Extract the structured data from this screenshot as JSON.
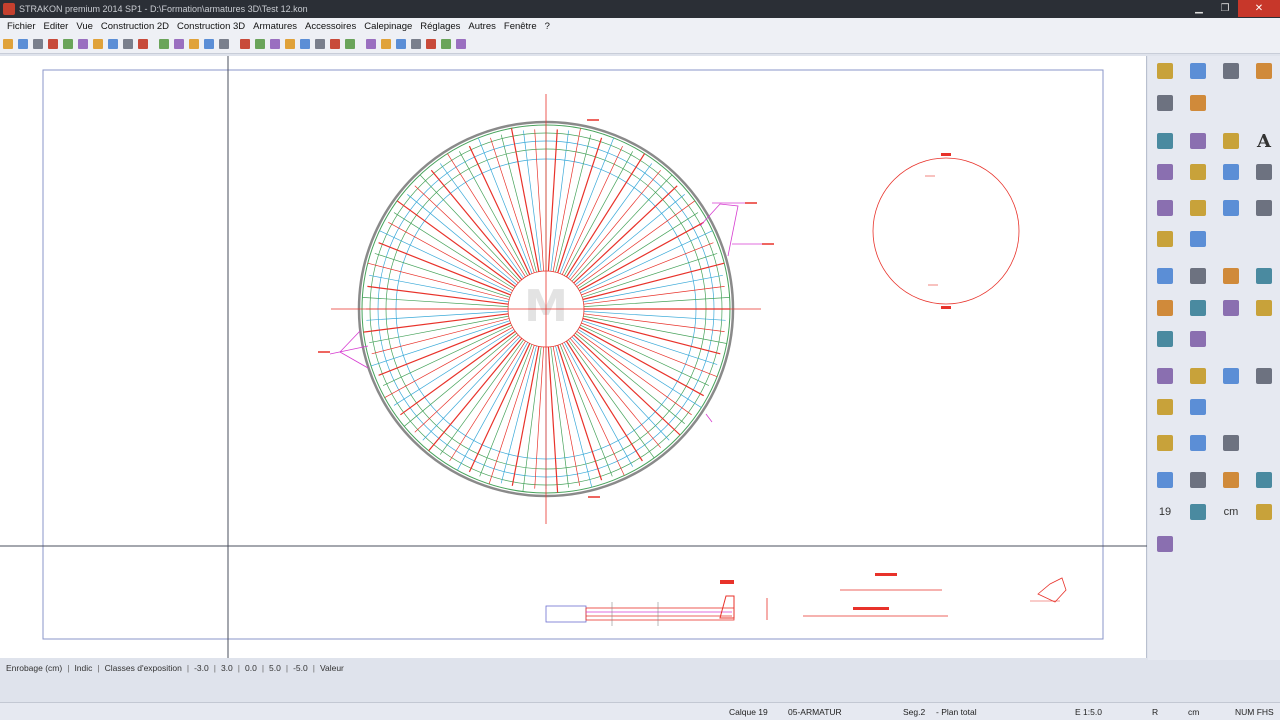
{
  "window": {
    "title": "STRAKON premium 2014 SP1 - D:\\Formation\\armatures 3D\\Test 12.kon",
    "minimize": "▁",
    "maximize": "❐",
    "close": "✕"
  },
  "menu": [
    "Fichier",
    "Editer",
    "Vue",
    "Construction 2D",
    "Construction 3D",
    "Armatures",
    "Accessoires",
    "Calepinage",
    "Réglages",
    "Autres",
    "Fenêtre",
    "?"
  ],
  "toolbar_icons": [
    "new-file-icon",
    "open-file-icon",
    "save-icon",
    "print-icon",
    "layout-icon",
    "copy-icon",
    "paste-icon",
    "view-icon",
    "settings-icon",
    "grid-icon",
    "layer-icon",
    "arrow-right-icon",
    "arrow-left-icon",
    "undo-icon",
    "redo-icon",
    "zoom-in-icon",
    "zoom-out-icon",
    "zoom-window-icon",
    "zoom-all-icon",
    "zoom-prev-icon",
    "zoom-next-icon",
    "zoom-fit-icon",
    "pan-icon",
    "snap-icon",
    "measure-icon",
    "mark-icon",
    "cross-icon",
    "select-icon",
    "filter-icon",
    "tools-icon"
  ],
  "right_panel": {
    "labels": {
      "number": "19",
      "unit": "cm",
      "text_tool": "A"
    }
  },
  "statusline": [
    "Enrobage (cm)",
    "Indic",
    "Classes d'exposition",
    "-3.0",
    "3.0",
    "0.0",
    "5.0",
    "-5.0",
    "Valeur"
  ],
  "bottom_status": {
    "layer": "Calque 19",
    "layer_name": "05-ARMATUR",
    "segment": "Seg.2",
    "plan": "- Plan total",
    "scale": "E 1:5.0",
    "r": "R",
    "unit": "cm",
    "keys": "NUM FHS"
  },
  "colors": {
    "rebar_red": "#e8322a",
    "rebar_cyan": "#3aa9d8",
    "rebar_green": "#46a25a",
    "dimension_magenta": "#d63bd0",
    "frame_blue": "#8a95c8"
  }
}
